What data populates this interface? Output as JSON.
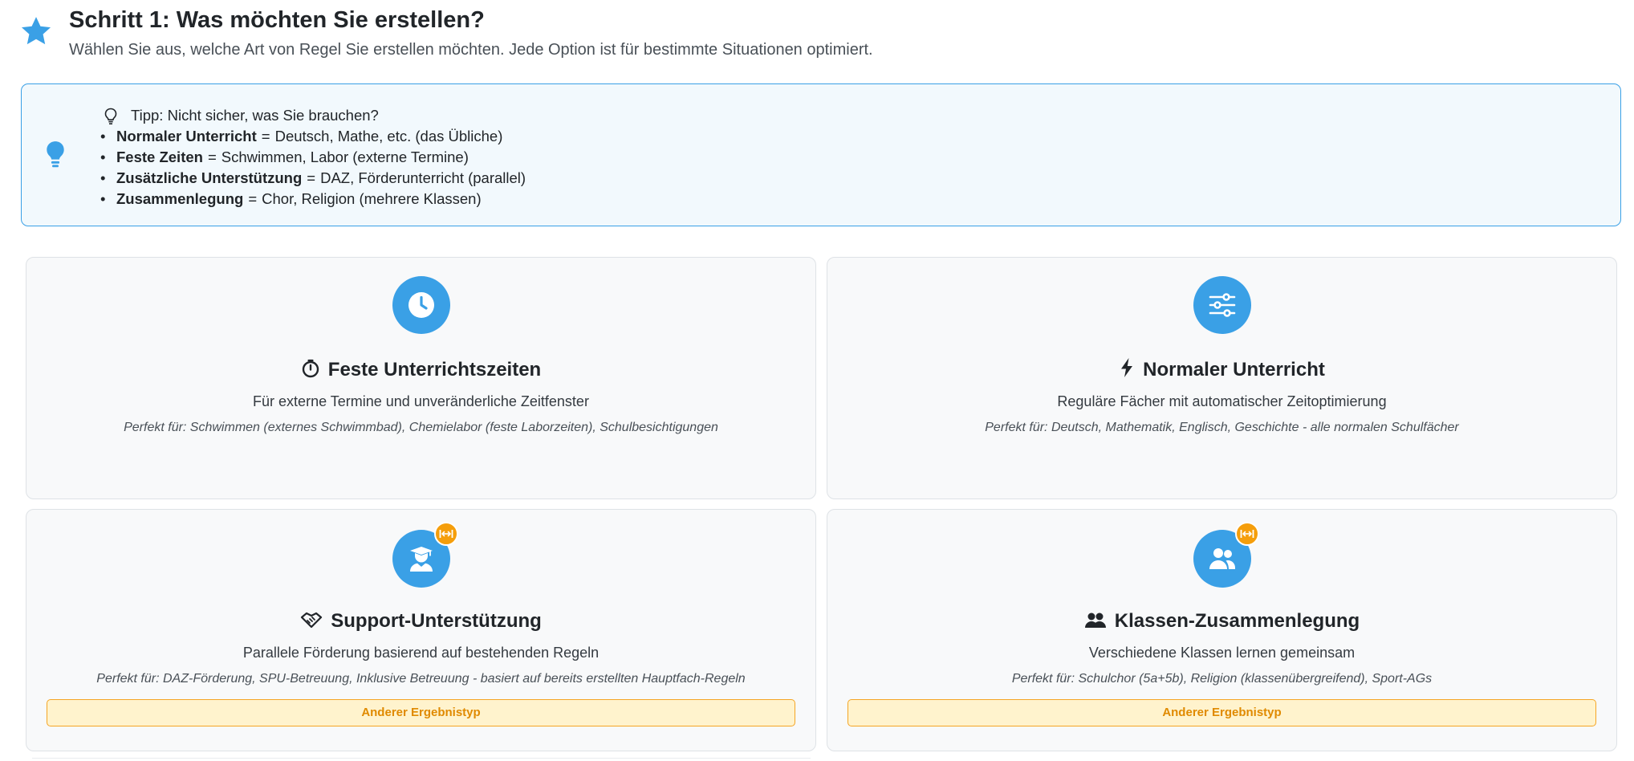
{
  "header": {
    "title": "Schritt 1: Was möchten Sie erstellen?",
    "subtitle": "Wählen Sie aus, welche Art von Regel Sie erstellen möchten. Jede Option ist für bestimmte Situationen optimiert.",
    "icon": "star-icon"
  },
  "tip": {
    "icon": "lightbulb-icon",
    "prefix": "Tipp:",
    "question": "Nicht sicher, was Sie brauchen?",
    "items": [
      {
        "term": "Normaler Unterricht",
        "eq": "=",
        "text": "Deutsch, Mathe, etc. (das Übliche)"
      },
      {
        "term": "Feste Zeiten",
        "eq": "=",
        "text": "Schwimmen, Labor (externe Termine)"
      },
      {
        "term": "Zusätzliche Unterstützung",
        "eq": "=",
        "text": "DAZ, Förderunterricht (parallel)"
      },
      {
        "term": "Zusammenlegung",
        "eq": "=",
        "text": "Chor, Religion (mehrere Klassen)"
      }
    ]
  },
  "cards": [
    {
      "icon": "clock-icon",
      "title_icon": "stopwatch-icon",
      "title": "Feste Unterrichtszeiten",
      "description": "Für externe Termine und unveränderliche Zeitfenster",
      "example": "Perfekt für: Schwimmen (externes Schwimmbad), Chemielabor (feste Laborzeiten), Schulbesichtigungen"
    },
    {
      "icon": "sliders-icon",
      "title_icon": "lightning-icon",
      "title": "Normaler Unterricht",
      "description": "Reguläre Fächer mit automatischer Zeitoptimierung",
      "example": "Perfekt für: Deutsch, Mathematik, Englisch, Geschichte - alle normalen Schulfächer"
    },
    {
      "icon": "teacher-icon",
      "badge_icon": "arrows-horizontal-icon",
      "title_icon": "handshake-icon",
      "title": "Support-Unterstützung",
      "description": "Parallele Förderung basierend auf bestehenden Regeln",
      "example": "Perfekt für: DAZ-Förderung, SPU-Betreuung, Inklusive Betreuung - basiert auf bereits erstellten Hauptfach-Regeln",
      "result_tag": "Anderer Ergebnistyp"
    },
    {
      "icon": "users-icon",
      "badge_icon": "arrows-horizontal-icon",
      "title_icon": "people-icon",
      "title": "Klassen-Zusammenlegung",
      "description": "Verschiedene Klassen lernen gemeinsam",
      "example": "Perfekt für: Schulchor (5a+5b), Religion (klassenübergreifend), Sport-AGs",
      "result_tag": "Anderer Ergebnistyp"
    }
  ],
  "colors": {
    "accent": "#3aa0e6",
    "badge": "#f59e0b",
    "tag_bg": "#fff3cd",
    "tag_border": "#f5a524",
    "tag_text": "#e08a00",
    "tip_bg": "#f2f9fd"
  }
}
